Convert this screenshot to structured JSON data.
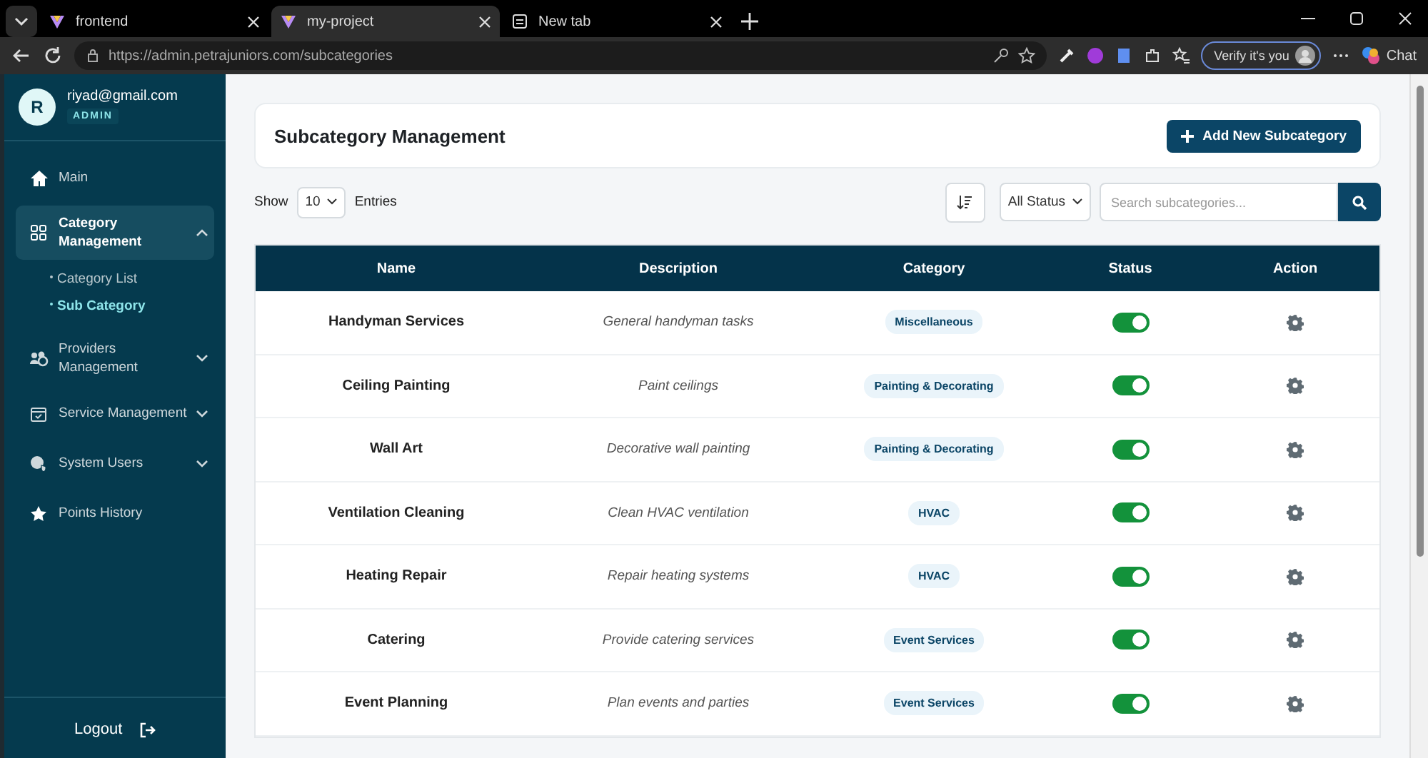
{
  "browser": {
    "tabs": [
      {
        "title": "frontend",
        "selected": false
      },
      {
        "title": "my-project",
        "selected": true
      },
      {
        "title": "New tab",
        "selected": false
      }
    ],
    "url": "https://admin.petrajuniors.com/subcategories",
    "profile_button": "Verify it's you",
    "chat_button": "Chat"
  },
  "sidebar": {
    "user": {
      "initial": "R",
      "email": "riyad@gmail.com",
      "role": "ADMIN"
    },
    "items": [
      {
        "kind": "link",
        "label": "Main",
        "selected": false
      },
      {
        "kind": "group",
        "label": "Category Management",
        "selected": true,
        "expanded": true,
        "children": [
          {
            "label": "Category List",
            "selected": false
          },
          {
            "label": "Sub Category",
            "selected": true
          }
        ]
      },
      {
        "kind": "group",
        "label": "Providers Management",
        "selected": false,
        "expanded": false
      },
      {
        "kind": "group",
        "label": "Service Management",
        "selected": false,
        "expanded": false
      },
      {
        "kind": "group",
        "label": "System Users",
        "selected": false,
        "expanded": false
      },
      {
        "kind": "link",
        "label": "Points History",
        "selected": false
      }
    ],
    "logout": "Logout"
  },
  "page": {
    "title": "Subcategory Management",
    "add_button": "Add New Subcategory",
    "show_label": "Show",
    "page_size": "10",
    "entries_label": "Entries",
    "status_filter": "All Status",
    "search": {
      "placeholder": "Search subcategories..."
    }
  },
  "table": {
    "columns": [
      "Name",
      "Description",
      "Category",
      "Status",
      "Action"
    ],
    "rows": [
      {
        "name": "Handyman Services",
        "description": "General handyman tasks",
        "category": "Miscellaneous",
        "on": true
      },
      {
        "name": "Ceiling Painting",
        "description": "Paint ceilings",
        "category": "Painting & Decorating",
        "on": true
      },
      {
        "name": "Wall Art",
        "description": "Decorative wall painting",
        "category": "Painting & Decorating",
        "on": true
      },
      {
        "name": "Ventilation Cleaning",
        "description": "Clean HVAC ventilation",
        "category": "HVAC",
        "on": true
      },
      {
        "name": "Heating Repair",
        "description": "Repair heating systems",
        "category": "HVAC",
        "on": true
      },
      {
        "name": "Catering",
        "description": "Provide catering services",
        "category": "Event Services",
        "on": true
      },
      {
        "name": "Event Planning",
        "description": "Plan events and parties",
        "category": "Event Services",
        "on": true
      }
    ]
  }
}
